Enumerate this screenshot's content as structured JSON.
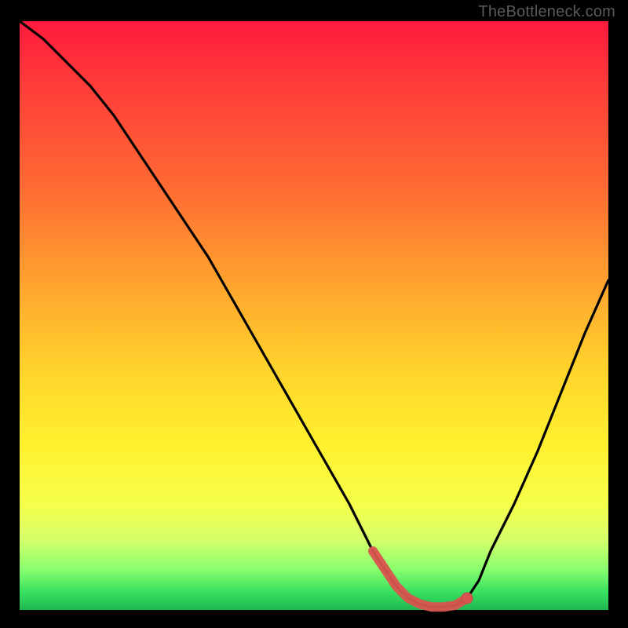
{
  "watermark": "TheBottleneck.com",
  "colors": {
    "frame": "#000000",
    "curve": "#000000",
    "marker_fill": "#d9544f",
    "marker_stroke": "#c24a45",
    "gradient_top": "#ff1a3d",
    "gradient_mid": "#fff12e",
    "gradient_bottom": "#1fb850"
  },
  "chart_data": {
    "type": "line",
    "title": "",
    "xlabel": "",
    "ylabel": "",
    "xlim": [
      0,
      100
    ],
    "ylim": [
      0,
      100
    ],
    "grid": false,
    "legend": false,
    "series": [
      {
        "name": "bottleneck-curve",
        "x": [
          0,
          4,
          8,
          12,
          16,
          20,
          24,
          28,
          32,
          36,
          40,
          44,
          48,
          52,
          56,
          58,
          60,
          62,
          64,
          66,
          68,
          70,
          72,
          74,
          76,
          78,
          80,
          84,
          88,
          92,
          96,
          100
        ],
        "y": [
          100,
          97,
          93,
          89,
          84,
          78,
          72,
          66,
          60,
          53,
          46,
          39,
          32,
          25,
          18,
          14,
          10,
          7,
          4,
          2,
          1,
          0.5,
          0.5,
          0.8,
          2,
          5,
          10,
          18,
          27,
          37,
          47,
          56
        ]
      }
    ],
    "highlight_segment": {
      "name": "optimal-range",
      "x": [
        60,
        62,
        64,
        66,
        68,
        70,
        72,
        74,
        76
      ],
      "y": [
        10,
        7,
        4,
        2,
        1,
        0.5,
        0.5,
        0.8,
        2
      ]
    },
    "marker": {
      "x": 76,
      "y": 2
    }
  }
}
